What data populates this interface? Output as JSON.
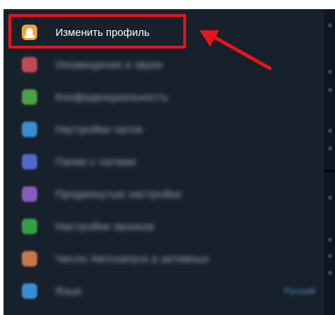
{
  "menu": {
    "items": [
      {
        "label": "Изменить профиль",
        "icon": "user-icon",
        "color": "#f0a33a",
        "blurred": false
      },
      {
        "label": "Оповещения и звуки",
        "icon": "bell-icon",
        "color": "#e0525c",
        "blurred": true
      },
      {
        "label": "Конфиденциальность",
        "icon": "lock-icon",
        "color": "#59b54a",
        "blurred": true
      },
      {
        "label": "Настройки чатов",
        "icon": "chat-icon",
        "color": "#3ea2ed",
        "blurred": true
      },
      {
        "label": "Папки с чатами",
        "icon": "folder-icon",
        "color": "#5b76e8",
        "blurred": true
      },
      {
        "label": "Продвинутые настройки",
        "icon": "settings-icon",
        "color": "#9a67d6",
        "blurred": true
      },
      {
        "label": "Настройки звонков",
        "icon": "phone-icon",
        "color": "#3cb64a",
        "blurred": true
      },
      {
        "label": "Число Автозапуск в активных",
        "icon": "battery-icon",
        "color": "#e8854f",
        "blurred": true
      },
      {
        "label": "Язык",
        "icon": "language-icon",
        "color": "#3ea2ed",
        "blurred": true,
        "value": "Русский"
      }
    ]
  },
  "colors": {
    "panel_bg": "#17212b",
    "highlight": "#e8141c",
    "arrow": "#e8141c"
  }
}
